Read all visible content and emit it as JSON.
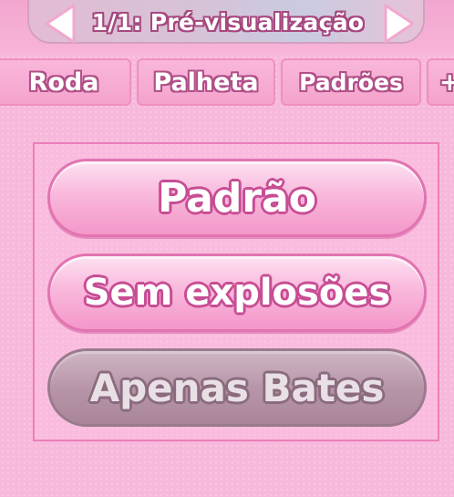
{
  "pager": {
    "title": "1/1: Pré-visualização",
    "prev_icon": "triangle-left-icon",
    "next_icon": "triangle-right-icon"
  },
  "tabs": [
    {
      "label": "Roda"
    },
    {
      "label": "Palheta"
    },
    {
      "label": "Padrões"
    },
    {
      "label": "+"
    }
  ],
  "options": [
    {
      "label": "Padrão",
      "state": "enabled"
    },
    {
      "label": "Sem explosões",
      "state": "enabled"
    },
    {
      "label": "Apenas Bates",
      "state": "selected"
    }
  ],
  "colors": {
    "background": "#f7b9db",
    "button_pink": "#f497c9",
    "button_outline": "#c74d94",
    "button_selected": "#b896aa"
  }
}
